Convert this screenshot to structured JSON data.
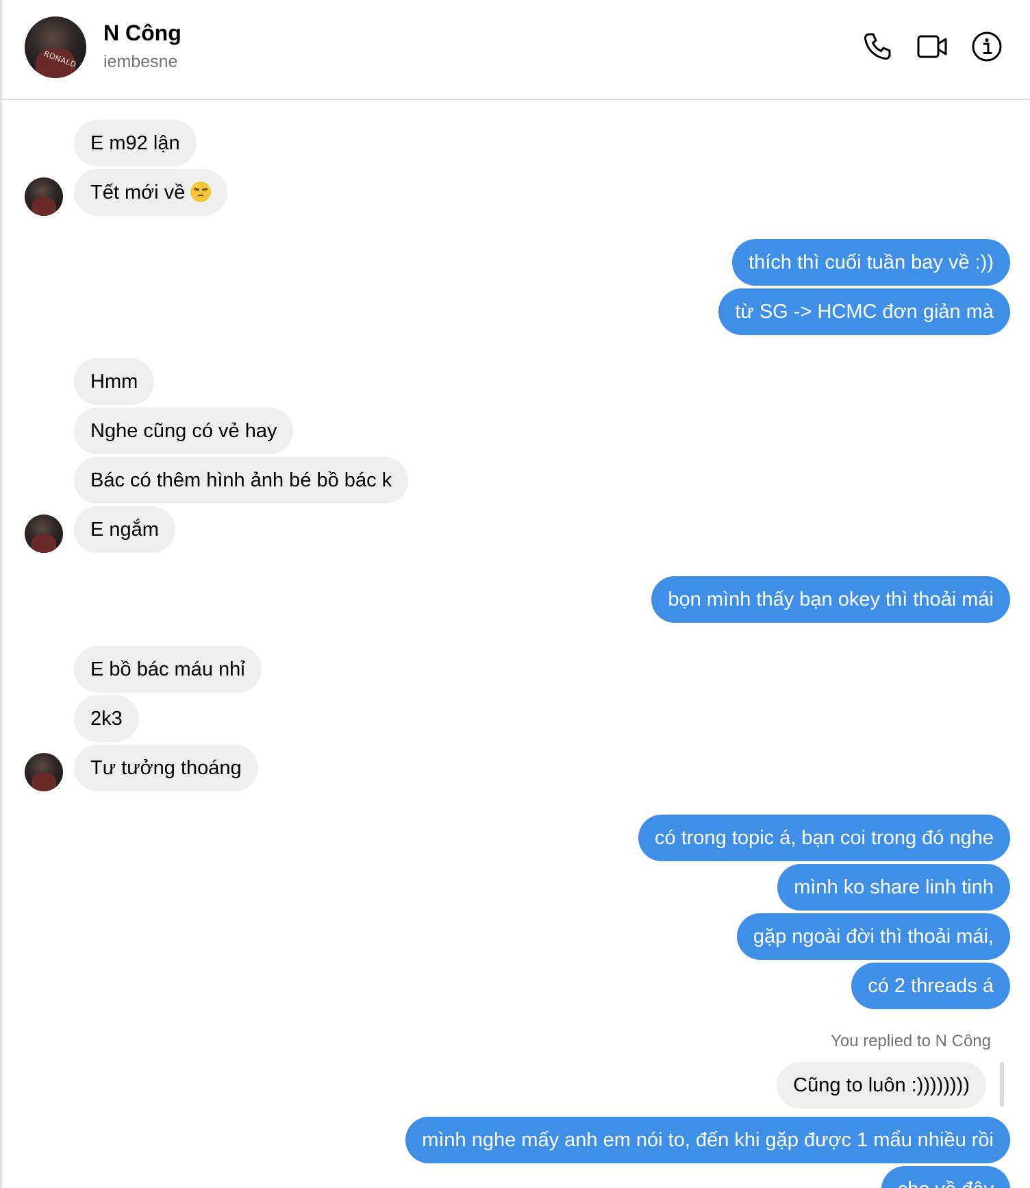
{
  "contact": {
    "name": "N Công",
    "username": "iembesne",
    "avatar_text": "RONALD"
  },
  "header_icons": [
    "phone-icon",
    "video-camera-icon",
    "info-icon"
  ],
  "colors": {
    "outgoing_bubble": "#3f8ee8",
    "incoming_bubble": "#efefef",
    "muted_text": "#737373"
  },
  "messages": {
    "m1": "E m92 lận",
    "m2": "Tết mới về",
    "m3": "thích thì cuối tuần bay về :))",
    "m4": "từ SG -> HCMC đơn giản mà",
    "m5": "Hmm",
    "m6": "Nghe cũng có vẻ hay",
    "m7": "Bác có thêm hình ảnh bé bồ bác k",
    "m8": "E ngắm",
    "m9": "bọn mình thấy bạn okey thì thoải mái",
    "m10": "E bồ bác máu nhỉ",
    "m11": "2k3",
    "m12": "Tư tưởng thoáng",
    "m13": "có trong topic á, bạn coi trong đó nghe",
    "m14": "mình ko share linh tinh",
    "m15": "gặp ngoài đời thì thoải mái,",
    "m16": "có 2 threads á",
    "m17": "mình nghe mấy anh em nói to, đến khi gặp được 1 mẩu nhiều rồi",
    "m18": "cho về đây"
  },
  "reply": {
    "label": "You replied to N Công",
    "quoted": "Cũng to luôn :))))))))"
  }
}
